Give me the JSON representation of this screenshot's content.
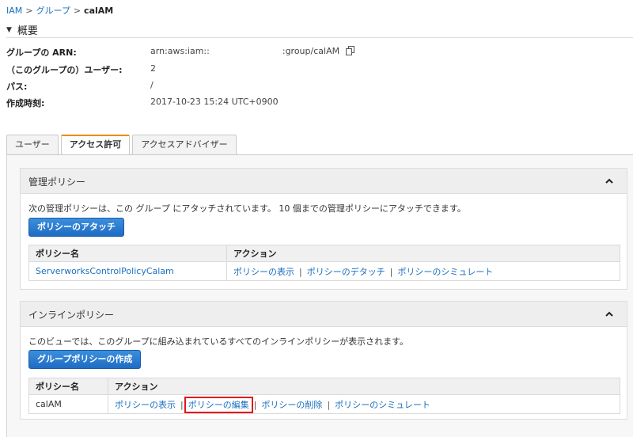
{
  "breadcrumb": {
    "items": [
      "IAM",
      "グループ"
    ],
    "separator": ">",
    "current": "calAM"
  },
  "summary": {
    "title": "概要",
    "rows": [
      {
        "label": "グループの ARN:",
        "value_prefix": "arn:aws:iam::",
        "value_suffix": ":group/calAM"
      },
      {
        "label": "（このグループの）ユーザー:",
        "value": "2"
      },
      {
        "label": "パス:",
        "value": "/"
      },
      {
        "label": "作成時刻:",
        "value": "2017-10-23 15:24 UTC+0900"
      }
    ]
  },
  "tabs": [
    {
      "label": "ユーザー",
      "active": false
    },
    {
      "label": "アクセス許可",
      "active": true
    },
    {
      "label": "アクセスアドバイザー",
      "active": false
    }
  ],
  "managed": {
    "title": "管理ポリシー",
    "description": "次の管理ポリシーは、この グループ にアタッチされています。 10 個までの管理ポリシーにアタッチできます。",
    "button": "ポリシーのアタッチ",
    "col_name": "ポリシー名",
    "col_action": "アクション",
    "row": {
      "name": "ServerworksControlPolicyCalam",
      "show": "ポリシーの表示",
      "detach": "ポリシーのデタッチ",
      "simulate": "ポリシーのシミュレート"
    }
  },
  "inline": {
    "title": "インラインポリシー",
    "description": "このビューでは、このグループに組み込まれているすべてのインラインポリシーが表示されます。",
    "button": "グループポリシーの作成",
    "col_name": "ポリシー名",
    "col_action": "アクション",
    "row": {
      "name": "calAM",
      "show": "ポリシーの表示",
      "edit": "ポリシーの編集",
      "delete": "ポリシーの削除",
      "simulate": "ポリシーのシミュレート"
    }
  },
  "pipe": "|",
  "colors": {
    "link": "#1a6fbf",
    "primary_button": "#1f6cc4",
    "active_tab_accent": "#ec8b00",
    "highlight_box": "#e3151a"
  },
  "icons": {
    "caret": "caret-down-icon",
    "copy": "copy-icon",
    "collapse": "chevron-up-icon"
  }
}
